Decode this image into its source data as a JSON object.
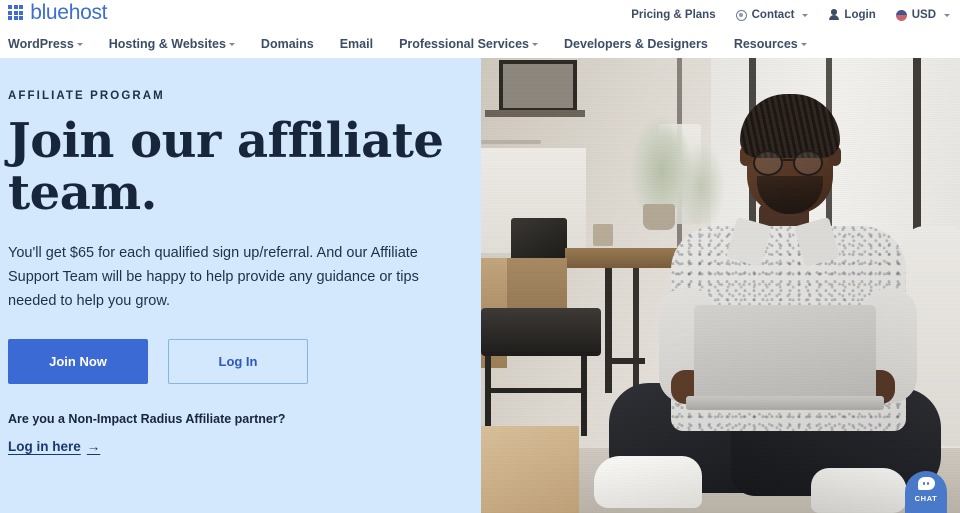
{
  "brand": {
    "name": "bluehost",
    "logo_icon": "grid-squares-icon",
    "color": "#3c6fd0"
  },
  "utility_nav": {
    "items": [
      {
        "label": "Pricing & Plans",
        "icon": null,
        "has_caret": false
      },
      {
        "label": "Contact",
        "icon": "headset-icon",
        "has_caret": true
      },
      {
        "label": "Login",
        "icon": "user-icon",
        "has_caret": false
      },
      {
        "label": "USD",
        "icon": "us-flag-icon",
        "has_caret": true
      }
    ]
  },
  "main_nav": {
    "items": [
      {
        "label": "WordPress",
        "has_caret": true
      },
      {
        "label": "Hosting & Websites",
        "has_caret": true
      },
      {
        "label": "Domains",
        "has_caret": false
      },
      {
        "label": "Email",
        "has_caret": false
      },
      {
        "label": "Professional Services",
        "has_caret": true
      },
      {
        "label": "Developers & Designers",
        "has_caret": false
      },
      {
        "label": "Resources",
        "has_caret": true
      }
    ]
  },
  "hero": {
    "eyebrow": "AFFILIATE PROGRAM",
    "headline": "Join our affiliate team.",
    "body": "You'll get $65 for each qualified sign up/referral. And our Affiliate Support Team will be happy to help provide any guidance or tips needed to help you grow.",
    "primary_button": "Join Now",
    "secondary_button": "Log In",
    "partner_question": "Are you a Non-Impact Radius Affiliate partner?",
    "partner_link": "Log in here",
    "partner_link_arrow": "→",
    "background_color": "#d3e7fd",
    "primary_button_color": "#3c6ad4",
    "heading_color": "#17263b",
    "photo_alt": "Man with glasses sitting cross-legged on the floor using a laptop in a bright modern room with large windows"
  },
  "chat_widget": {
    "label": "CHAT",
    "icon": "chat-bubble-icon",
    "color": "#4a79c9"
  }
}
